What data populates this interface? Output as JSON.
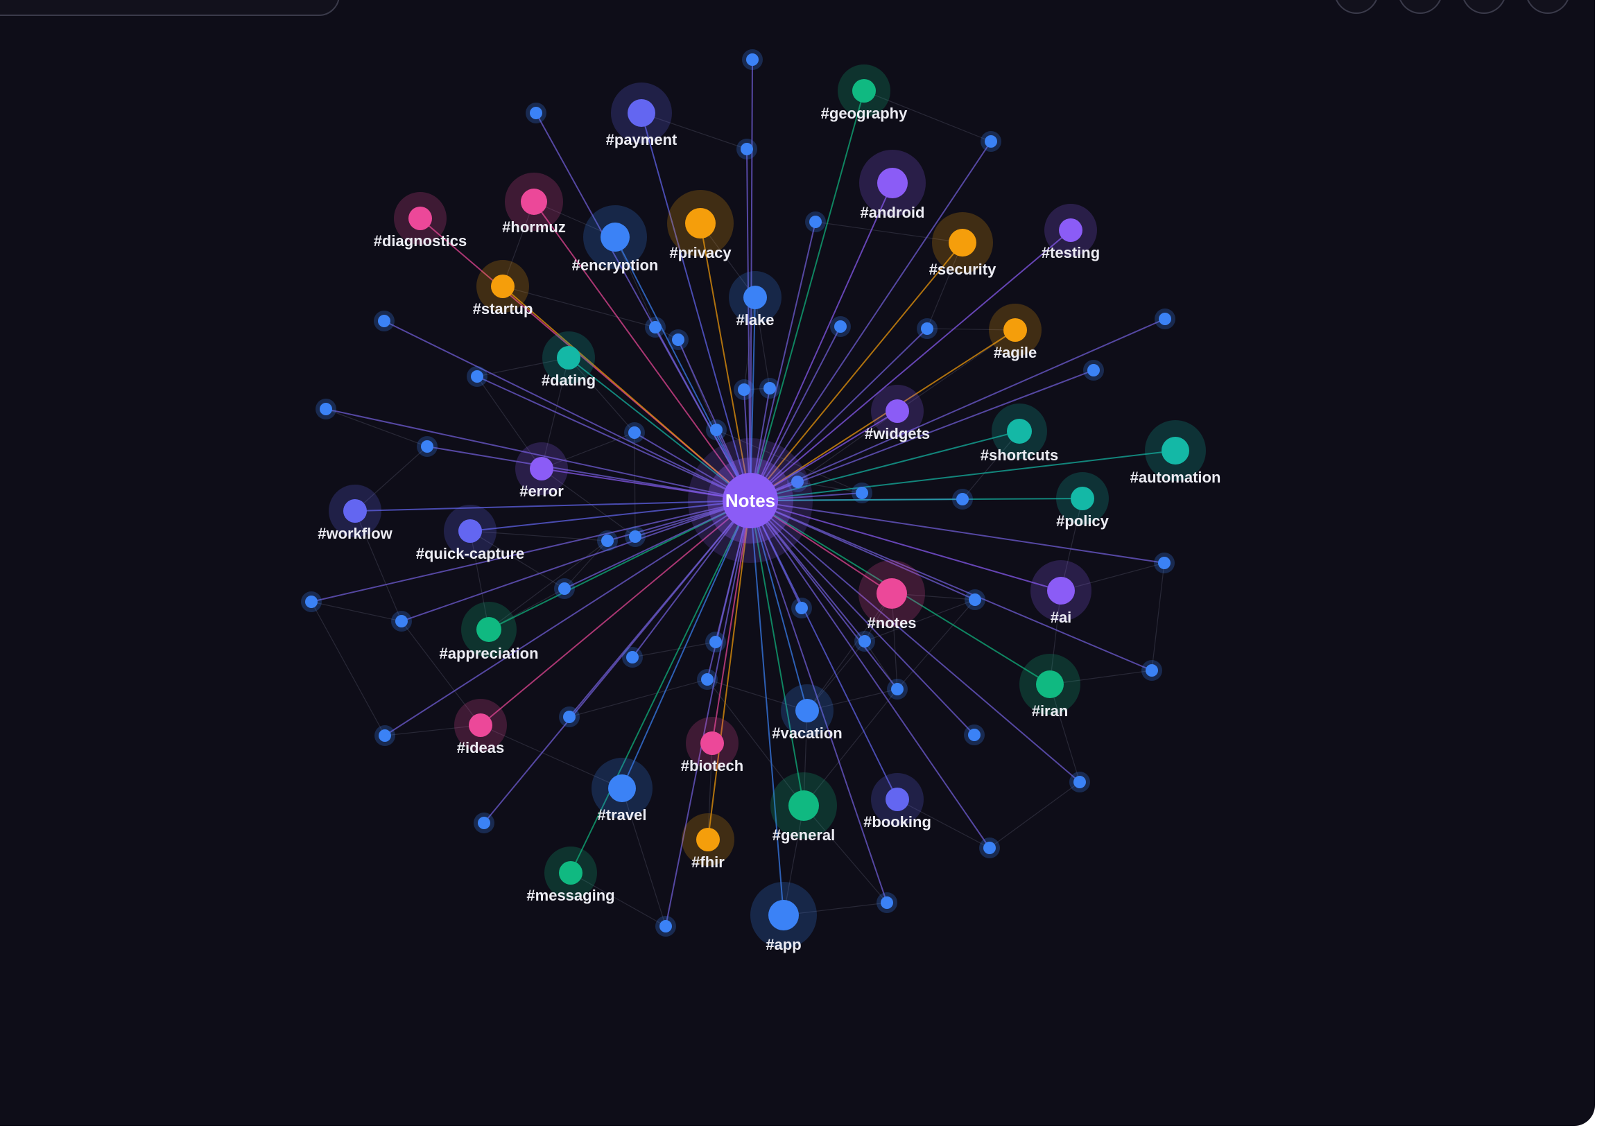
{
  "header": {
    "filter_label": ""
  },
  "colors": {
    "background": "#0e0d18",
    "center": "#8b5cf6",
    "blue": "#3b82f6",
    "indigo": "#6366f1",
    "violet": "#8b5cf6",
    "pink": "#ec4899",
    "amber": "#f59e0b",
    "emerald": "#10b981",
    "teal": "#14b8a6"
  },
  "center": {
    "label": "Notes"
  },
  "tags": [
    {
      "label": "#payment",
      "color": "indigo"
    },
    {
      "label": "#geography",
      "color": "emerald"
    },
    {
      "label": "#android",
      "color": "violet"
    },
    {
      "label": "#hormuz",
      "color": "pink"
    },
    {
      "label": "#diagnostics",
      "color": "pink"
    },
    {
      "label": "#encryption",
      "color": "blue"
    },
    {
      "label": "#privacy",
      "color": "amber"
    },
    {
      "label": "#security",
      "color": "amber"
    },
    {
      "label": "#testing",
      "color": "violet"
    },
    {
      "label": "#startup",
      "color": "amber"
    },
    {
      "label": "#lake",
      "color": "blue"
    },
    {
      "label": "#agile",
      "color": "amber"
    },
    {
      "label": "#dating",
      "color": "teal"
    },
    {
      "label": "#widgets",
      "color": "violet"
    },
    {
      "label": "#shortcuts",
      "color": "teal"
    },
    {
      "label": "#automation",
      "color": "teal"
    },
    {
      "label": "#error",
      "color": "violet"
    },
    {
      "label": "#workflow",
      "color": "indigo"
    },
    {
      "label": "#quick-capture",
      "color": "indigo"
    },
    {
      "label": "#policy",
      "color": "teal"
    },
    {
      "label": "#notes",
      "color": "pink"
    },
    {
      "label": "#ai",
      "color": "violet"
    },
    {
      "label": "#appreciation",
      "color": "emerald"
    },
    {
      "label": "#iran",
      "color": "emerald"
    },
    {
      "label": "#vacation",
      "color": "blue"
    },
    {
      "label": "#ideas",
      "color": "pink"
    },
    {
      "label": "#biotech",
      "color": "pink"
    },
    {
      "label": "#travel",
      "color": "blue"
    },
    {
      "label": "#general",
      "color": "emerald"
    },
    {
      "label": "#booking",
      "color": "indigo"
    },
    {
      "label": "#fhir",
      "color": "amber"
    },
    {
      "label": "#messaging",
      "color": "emerald"
    },
    {
      "label": "#app",
      "color": "blue"
    }
  ],
  "note_node_count": 44
}
